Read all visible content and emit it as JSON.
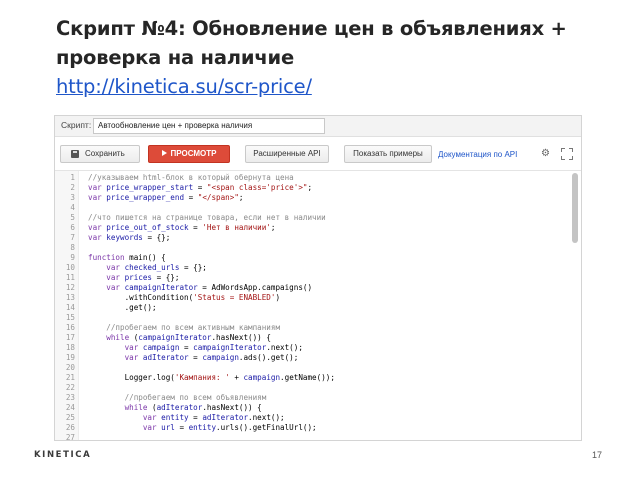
{
  "slide": {
    "title": "Скрипт №4: Обновление цен в объявлениях + проверка на наличие",
    "link": "http://kinetica.su/scr-price/",
    "logo": "KINETICA",
    "page_number": "17"
  },
  "editor": {
    "script_label": "Скрипт:",
    "script_name": "Автообновление цен + проверка наличия",
    "toolbar": {
      "save_label": "Сохранить",
      "preview_label": "ПРОСМОТР",
      "advanced_api_label": "Расширенные API",
      "examples_label": "Показать примеры",
      "api_docs_label": "Документация по API"
    },
    "code_lines": [
      {
        "n": "1",
        "tokens": [
          {
            "t": "//указываем html-блок в который обернута цена",
            "c": "c"
          }
        ]
      },
      {
        "n": "2",
        "tokens": [
          {
            "t": "var ",
            "c": "k"
          },
          {
            "t": "price_wrapper_start",
            "c": "v"
          },
          {
            "t": " = ",
            "c": "p"
          },
          {
            "t": "\"<span class='price'>\"",
            "c": "s"
          },
          {
            "t": ";",
            "c": "p"
          }
        ]
      },
      {
        "n": "3",
        "tokens": [
          {
            "t": "var ",
            "c": "k"
          },
          {
            "t": "price_wrapper_end",
            "c": "v"
          },
          {
            "t": " = ",
            "c": "p"
          },
          {
            "t": "\"</span>\"",
            "c": "s"
          },
          {
            "t": ";",
            "c": "p"
          }
        ]
      },
      {
        "n": "4",
        "tokens": []
      },
      {
        "n": "5",
        "tokens": [
          {
            "t": "//что пишется на странице товара, если нет в наличии",
            "c": "c"
          }
        ]
      },
      {
        "n": "6",
        "tokens": [
          {
            "t": "var ",
            "c": "k"
          },
          {
            "t": "price_out_of_stock",
            "c": "v"
          },
          {
            "t": " = ",
            "c": "p"
          },
          {
            "t": "'Нет в наличии'",
            "c": "s"
          },
          {
            "t": ";",
            "c": "p"
          }
        ]
      },
      {
        "n": "7",
        "tokens": [
          {
            "t": "var ",
            "c": "k"
          },
          {
            "t": "keywords",
            "c": "v"
          },
          {
            "t": " = {};",
            "c": "p"
          }
        ]
      },
      {
        "n": "8",
        "tokens": []
      },
      {
        "n": "9",
        "tokens": [
          {
            "t": "function ",
            "c": "k"
          },
          {
            "t": "main",
            "c": "f"
          },
          {
            "t": "() {",
            "c": "p"
          }
        ]
      },
      {
        "n": "10",
        "tokens": [
          {
            "t": "    var ",
            "c": "k"
          },
          {
            "t": "checked_urls",
            "c": "v"
          },
          {
            "t": " = {};",
            "c": "p"
          }
        ]
      },
      {
        "n": "11",
        "tokens": [
          {
            "t": "    var ",
            "c": "k"
          },
          {
            "t": "prices",
            "c": "v"
          },
          {
            "t": " = {};",
            "c": "p"
          }
        ]
      },
      {
        "n": "12",
        "tokens": [
          {
            "t": "    var ",
            "c": "k"
          },
          {
            "t": "campaignIterator",
            "c": "v"
          },
          {
            "t": " = AdWordsApp.campaigns()",
            "c": "p"
          }
        ]
      },
      {
        "n": "13",
        "tokens": [
          {
            "t": "        .withCondition(",
            "c": "p"
          },
          {
            "t": "'Status = ENABLED'",
            "c": "s"
          },
          {
            "t": ")",
            "c": "p"
          }
        ]
      },
      {
        "n": "14",
        "tokens": [
          {
            "t": "        .get();",
            "c": "p"
          }
        ]
      },
      {
        "n": "15",
        "tokens": []
      },
      {
        "n": "16",
        "tokens": [
          {
            "t": "    //пробегаем по всем активным кампаниям",
            "c": "c"
          }
        ]
      },
      {
        "n": "17",
        "tokens": [
          {
            "t": "    while ",
            "c": "k"
          },
          {
            "t": "(",
            "c": "p"
          },
          {
            "t": "campaignIterator",
            "c": "v"
          },
          {
            "t": ".hasNext()) {",
            "c": "p"
          }
        ]
      },
      {
        "n": "18",
        "tokens": [
          {
            "t": "        var ",
            "c": "k"
          },
          {
            "t": "campaign",
            "c": "v"
          },
          {
            "t": " = ",
            "c": "p"
          },
          {
            "t": "campaignIterator",
            "c": "v"
          },
          {
            "t": ".next();",
            "c": "p"
          }
        ]
      },
      {
        "n": "19",
        "tokens": [
          {
            "t": "        var ",
            "c": "k"
          },
          {
            "t": "adIterator",
            "c": "v"
          },
          {
            "t": " = ",
            "c": "p"
          },
          {
            "t": "campaign",
            "c": "v"
          },
          {
            "t": ".ads().get();",
            "c": "p"
          }
        ]
      },
      {
        "n": "20",
        "tokens": []
      },
      {
        "n": "21",
        "tokens": [
          {
            "t": "        Logger.log(",
            "c": "p"
          },
          {
            "t": "'Кампания: '",
            "c": "s"
          },
          {
            "t": " + ",
            "c": "p"
          },
          {
            "t": "campaign",
            "c": "v"
          },
          {
            "t": ".getName());",
            "c": "p"
          }
        ]
      },
      {
        "n": "22",
        "tokens": []
      },
      {
        "n": "23",
        "tokens": [
          {
            "t": "        //пробегаем по всем объявлениям",
            "c": "c"
          }
        ]
      },
      {
        "n": "24",
        "tokens": [
          {
            "t": "        while ",
            "c": "k"
          },
          {
            "t": "(",
            "c": "p"
          },
          {
            "t": "adIterator",
            "c": "v"
          },
          {
            "t": ".hasNext()) {",
            "c": "p"
          }
        ]
      },
      {
        "n": "25",
        "tokens": [
          {
            "t": "            var ",
            "c": "k"
          },
          {
            "t": "entity",
            "c": "v"
          },
          {
            "t": " = ",
            "c": "p"
          },
          {
            "t": "adIterator",
            "c": "v"
          },
          {
            "t": ".next();",
            "c": "p"
          }
        ]
      },
      {
        "n": "26",
        "tokens": [
          {
            "t": "            var ",
            "c": "k"
          },
          {
            "t": "url",
            "c": "v"
          },
          {
            "t": " = ",
            "c": "p"
          },
          {
            "t": "entity",
            "c": "v"
          },
          {
            "t": ".urls().getFinalUrl();",
            "c": "p"
          }
        ]
      },
      {
        "n": "27",
        "tokens": []
      }
    ]
  },
  "icons": {
    "save": "floppy-disk-icon",
    "preview": "play-icon",
    "settings": "gear-icon",
    "fullscreen": "expand-icon"
  },
  "colors": {
    "preview_button": "#dd4b39",
    "link": "#1f56c9",
    "keyword": "#7b36a8",
    "variable": "#1a1aa6",
    "string": "#a31515",
    "comment": "#8a8a8a"
  }
}
